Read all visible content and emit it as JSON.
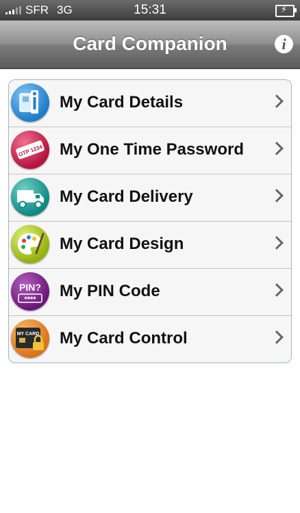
{
  "status_bar": {
    "carrier": "SFR",
    "network": "3G",
    "time": "15:31"
  },
  "nav": {
    "title": "Card Companion",
    "info_icon": "info-icon"
  },
  "menu": {
    "items": [
      {
        "label": "My Card Details",
        "icon": "card-details-icon",
        "color": "#2d8fd6"
      },
      {
        "label": "My One Time Password",
        "icon": "one-time-password-icon",
        "color": "#c8234a",
        "icon_text": "OTP 1234"
      },
      {
        "label": "My Card Delivery",
        "icon": "delivery-truck-icon",
        "color": "#149c93"
      },
      {
        "label": "My Card Design",
        "icon": "palette-icon",
        "color": "#a9c61a"
      },
      {
        "label": "My PIN Code",
        "icon": "pin-code-icon",
        "color": "#7b2486",
        "icon_text": "PIN?",
        "icon_mask": "****"
      },
      {
        "label": "My Card Control",
        "icon": "card-lock-icon",
        "color": "#e8902a",
        "icon_text": "MY CARD"
      }
    ]
  }
}
